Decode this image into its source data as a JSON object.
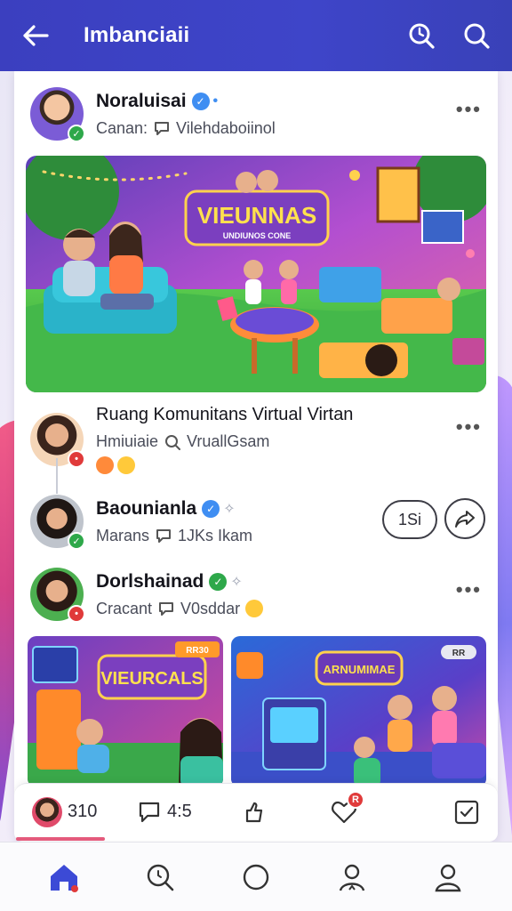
{
  "header": {
    "title": "Imbanciaii",
    "icons": [
      "back-arrow-icon",
      "search-refresh-icon",
      "search-icon"
    ]
  },
  "posts": [
    {
      "name": "Noraluisai",
      "meta_left": "Canan:",
      "meta_right": "Vilehdaboiinol",
      "badge_color": "#2ea84a"
    },
    {
      "name": "Ruang Komunitans Virtual Virtan",
      "meta_left": "Hmiuiaie",
      "meta_right": "VruallGsam",
      "badge_color": "#e03a3a"
    },
    {
      "name": "Baounianla",
      "meta_left": "Marans",
      "meta_right": "1JKs Ikam",
      "badge_color": "#2ea84a",
      "pill_label": "1Si"
    },
    {
      "name": "Dorlshainad",
      "meta_left": "Cracant",
      "meta_right": "V0sddar",
      "badge_color": "#e03a3a"
    }
  ],
  "hero_banner": {
    "title": "VIEUNNAS",
    "subtitle": "UNDIUNOS CONE"
  },
  "tile_left": {
    "title": "VIEURCALS",
    "tag": "RR30"
  },
  "tile_right": {
    "title": "ARNUMIMAE",
    "tag": "RR"
  },
  "actions": {
    "likes": "310",
    "comments": "4:5",
    "notif_badge": "R"
  },
  "colors": {
    "header_bg": "#3b3fbf",
    "home_active": "#3c4ad6",
    "accent_pink": "#e45a7c"
  }
}
